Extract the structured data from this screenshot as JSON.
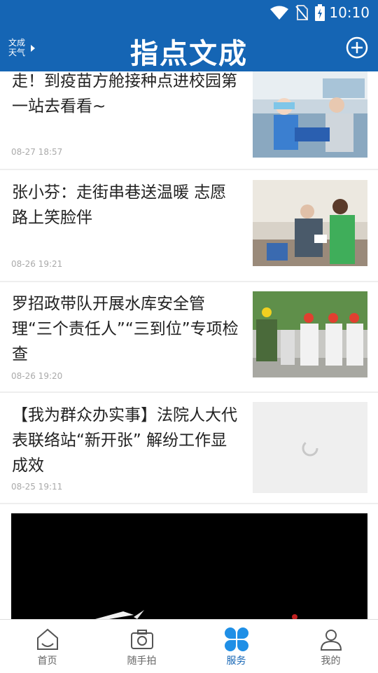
{
  "status_bar": {
    "time": "10:10"
  },
  "header": {
    "weather_label": "文成\n天气",
    "weather_line1": "文成",
    "weather_line2": "天气",
    "title": "指点文成"
  },
  "news": [
    {
      "title": "走！到疫苗方舱接种点进校园第一站去看看~",
      "date": "08-27 18:57",
      "image": "vaccination-photo"
    },
    {
      "title": "张小芬：走街串巷送温暖 志愿路上笑脸伴",
      "date": "08-26 19:21",
      "image": "volunteer-photo"
    },
    {
      "title": "罗招政带队开展水库安全管理“三个责任人”“三到位”专项检查",
      "date": "08-26 19:20",
      "image": "reservoir-inspection-photo"
    },
    {
      "title": "【我为群众办实事】法院人大代表联络站“新开张” 解纷工作显成效",
      "date": "08-25 19:11",
      "image": "loading-placeholder"
    }
  ],
  "tabs": [
    {
      "label": "首页",
      "icon": "home-icon",
      "active": false
    },
    {
      "label": "随手拍",
      "icon": "camera-icon",
      "active": false
    },
    {
      "label": "服务",
      "icon": "clover-icon",
      "active": true
    },
    {
      "label": "我的",
      "icon": "user-icon",
      "active": false
    }
  ],
  "colors": {
    "brand_blue": "#1565b4",
    "active_tab": "#1565b4"
  }
}
